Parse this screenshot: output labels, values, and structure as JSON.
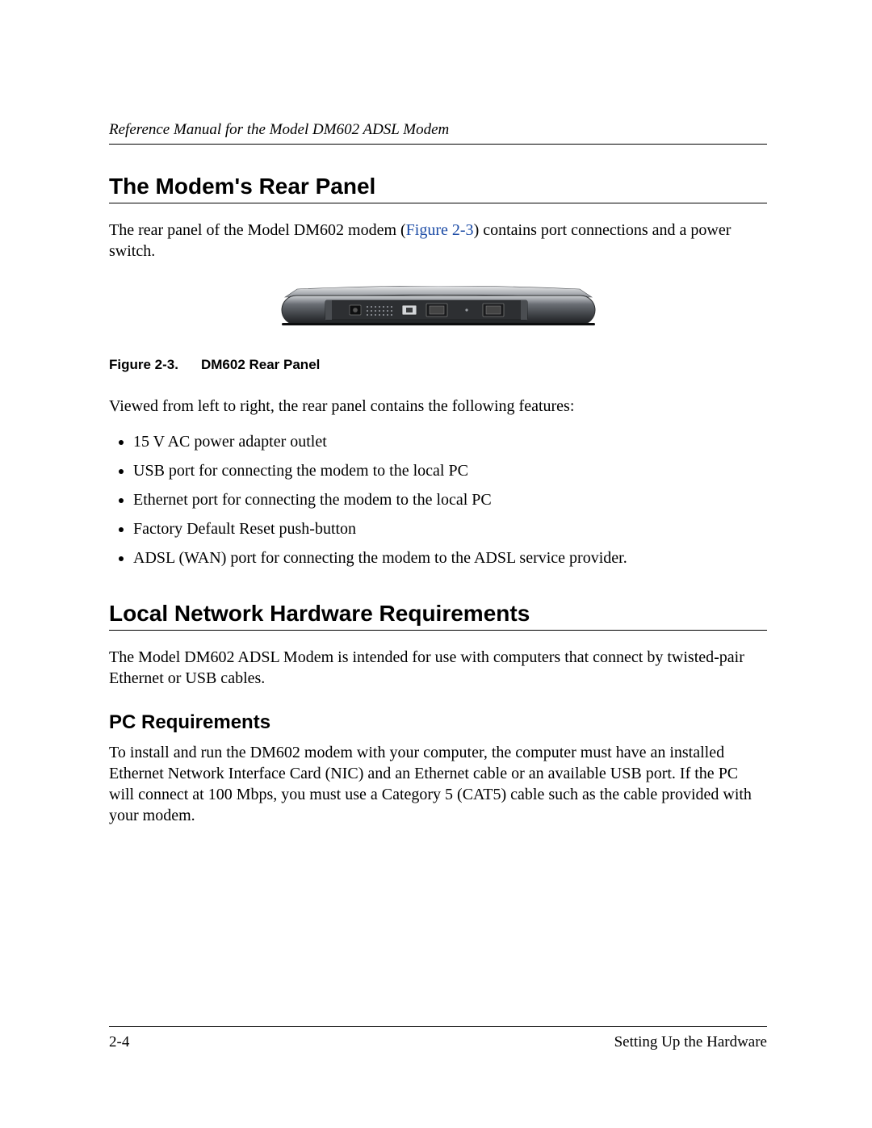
{
  "header": {
    "running_title": "Reference Manual for the Model DM602 ADSL Modem"
  },
  "section1": {
    "title": "The Modem's Rear Panel",
    "intro_pre": "The rear panel of the Model DM602 modem (",
    "figure_link": "Figure 2-3",
    "intro_post": ") contains port connections and a power switch."
  },
  "figure": {
    "caption_label": "Figure 2-3.",
    "caption_text": "DM602 Rear Panel"
  },
  "features_intro": "Viewed from left to right, the rear panel contains the following features:",
  "features": [
    "15 V AC power adapter outlet",
    "USB port for connecting the modem to the local PC",
    "Ethernet port for connecting the modem to the local PC",
    "Factory Default Reset push-button",
    "ADSL (WAN) port for connecting the modem to the ADSL service provider."
  ],
  "section2": {
    "title": "Local Network Hardware Requirements",
    "intro": "The Model DM602 ADSL Modem  is intended for use with computers that connect by twisted-pair Ethernet or USB cables."
  },
  "subsection": {
    "title": "PC Requirements",
    "body": "To install and run the DM602 modem with your computer, the computer must have an installed Ethernet Network Interface Card (NIC) and an Ethernet cable or an available USB port. If the PC will connect at 100 Mbps, you must use a Category 5 (CAT5) cable such as the cable provided with your modem."
  },
  "footer": {
    "page_number": "2-4",
    "chapter": "Setting Up the Hardware"
  }
}
